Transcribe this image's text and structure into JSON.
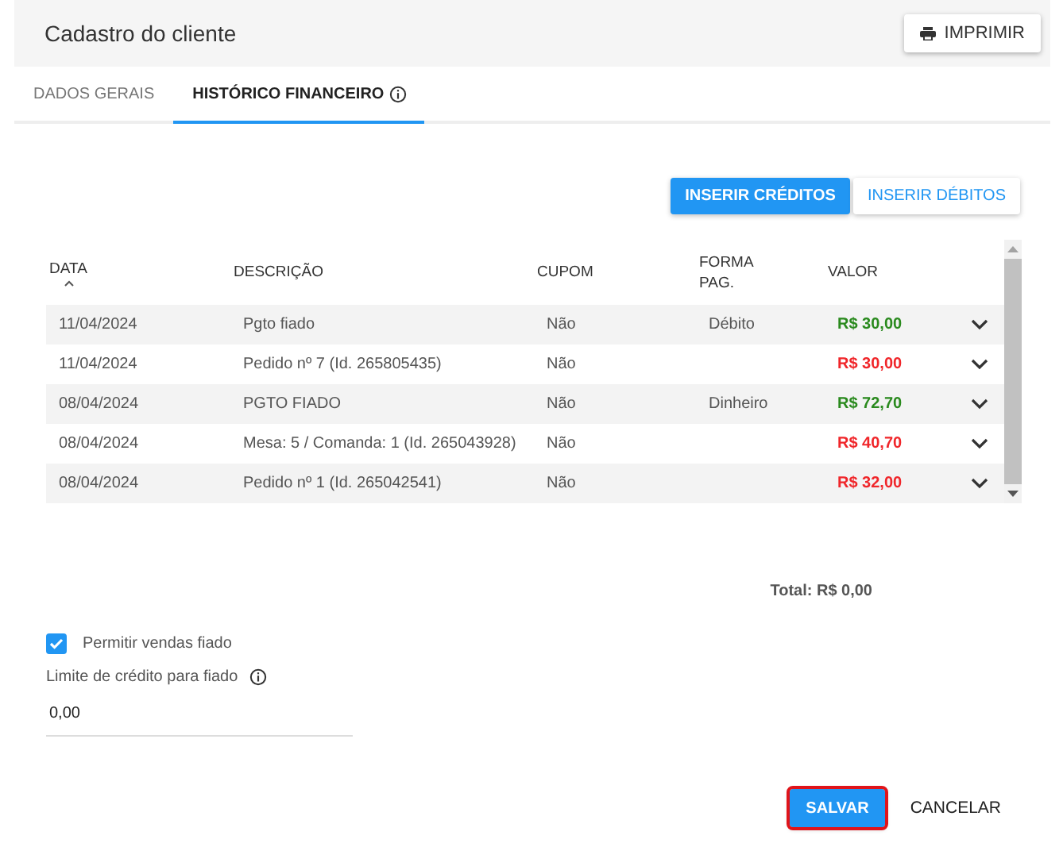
{
  "header": {
    "title": "Cadastro do cliente",
    "print_button": "IMPRIMIR"
  },
  "tabs": [
    {
      "label": "DADOS GERAIS",
      "selected": false,
      "info": false
    },
    {
      "label": "HISTÓRICO FINANCEIRO",
      "selected": true,
      "info": true
    }
  ],
  "actions": [
    {
      "label": "INSERIR CRÉDITOS",
      "kind": "primary"
    },
    {
      "label": "INSERIR DÉBITOS",
      "kind": "secondary"
    }
  ],
  "table": {
    "columns": [
      "DATA",
      "DESCRIÇÃO",
      "CUPOM",
      "FORMA PAG.",
      "VALOR"
    ],
    "rows": [
      {
        "data": "11/04/2024",
        "descricao": "Pgto fiado",
        "cupom": "Não",
        "forma_pag": "Débito",
        "valor": "R$ 30,00",
        "kind": "credit"
      },
      {
        "data": "11/04/2024",
        "descricao": "Pedido nº 7 (Id. 265805435)",
        "cupom": "Não",
        "forma_pag": "",
        "valor": "R$ 30,00",
        "kind": "debit"
      },
      {
        "data": "08/04/2024",
        "descricao": "PGTO FIADO",
        "cupom": "Não",
        "forma_pag": "Dinheiro",
        "valor": "R$ 72,70",
        "kind": "credit"
      },
      {
        "data": "08/04/2024",
        "descricao": "Mesa: 5 / Comanda: 1 (Id. 265043928)",
        "cupom": "Não",
        "forma_pag": "",
        "valor": "R$ 40,70",
        "kind": "debit"
      },
      {
        "data": "08/04/2024",
        "descricao": "Pedido nº 1 (Id. 265042541)",
        "cupom": "Não",
        "forma_pag": "",
        "valor": "R$ 32,00",
        "kind": "debit"
      }
    ]
  },
  "total": "Total: R$ 0,00",
  "allow_credit": {
    "label": "Permitir vendas fiado",
    "checked": true
  },
  "credit_limit": {
    "label": "Limite de crédito para fiado",
    "value": "0,00"
  },
  "buttons": [
    {
      "label": "SALVAR",
      "kind": "primary",
      "highlighted": true
    },
    {
      "label": "CANCELAR",
      "kind": "text",
      "highlighted": false
    }
  ]
}
